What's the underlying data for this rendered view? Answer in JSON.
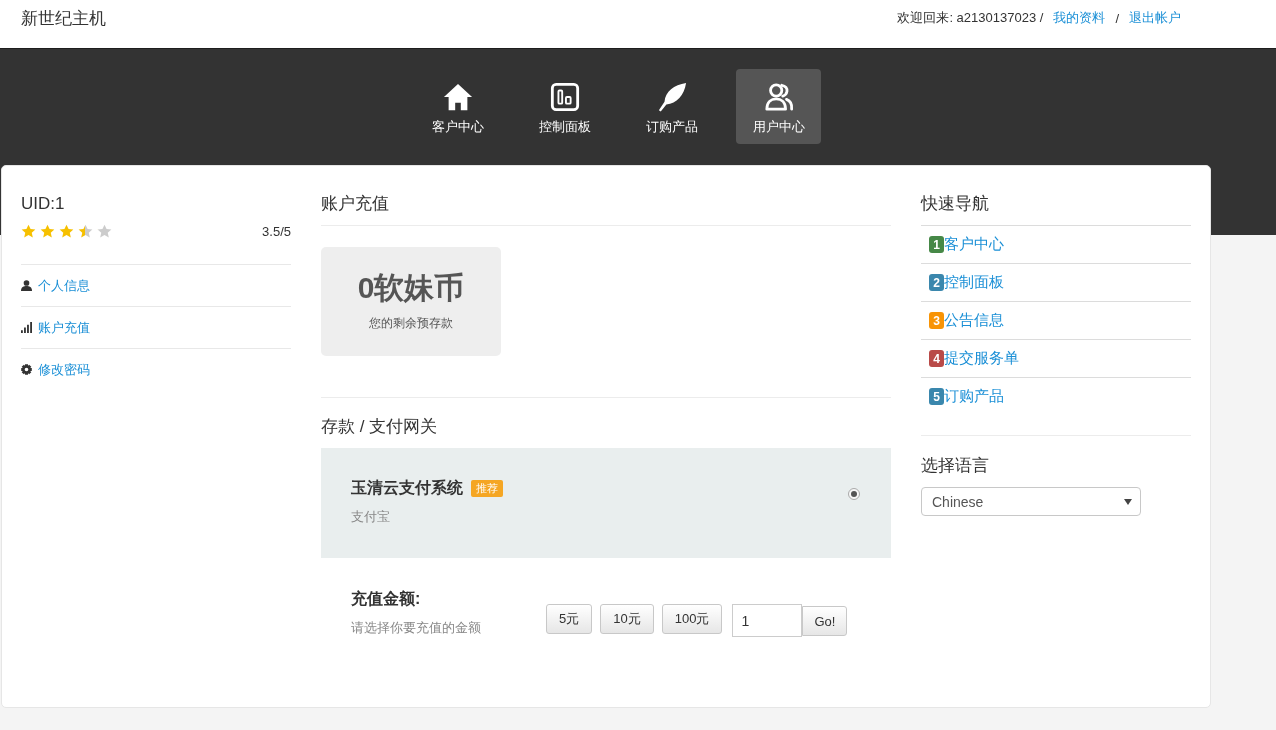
{
  "header": {
    "title": "新世纪主机",
    "welcome": "欢迎回来: a2130137023 /",
    "profile_link": "我的资料",
    "separator": "/",
    "logout_link": "退出帐户"
  },
  "nav": [
    {
      "label": "客户中心",
      "selected": false
    },
    {
      "label": "控制面板",
      "selected": false
    },
    {
      "label": "订购产品",
      "selected": false
    },
    {
      "label": "用户中心",
      "selected": true
    }
  ],
  "profile": {
    "uid": "UID:1",
    "stars": 3.5,
    "rating": "3.5/5",
    "menu": [
      "个人信息",
      "账户充值",
      "修改密码"
    ]
  },
  "recharge": {
    "title": "账户充值",
    "balance": "0软妹币",
    "balance_caption": "您的剩余预存款",
    "gateway_title": "存款 / 支付网关",
    "gateways": [
      {
        "name": "玉清云支付系统",
        "badge": "推荐",
        "method": "支付宝",
        "selected": true
      }
    ],
    "amount_label": "充值金额:",
    "amount_hint": "请选择你要充值的金额",
    "presets": [
      "5元",
      "10元",
      "100元"
    ],
    "amount_value": "1",
    "submit": "Go!"
  },
  "quick_nav": {
    "title": "快速导航",
    "items": [
      {
        "number": "1",
        "label": "客户中心",
        "color": "#468847"
      },
      {
        "number": "2",
        "label": "控制面板",
        "color": "#3a87ad"
      },
      {
        "number": "3",
        "label": "公告信息",
        "color": "#f89406"
      },
      {
        "number": "4",
        "label": "提交服务单",
        "color": "#b94a48"
      },
      {
        "number": "5",
        "label": "订购产品",
        "color": "#3a87ad"
      }
    ]
  },
  "language": {
    "title": "选择语言",
    "value": "Chinese"
  }
}
